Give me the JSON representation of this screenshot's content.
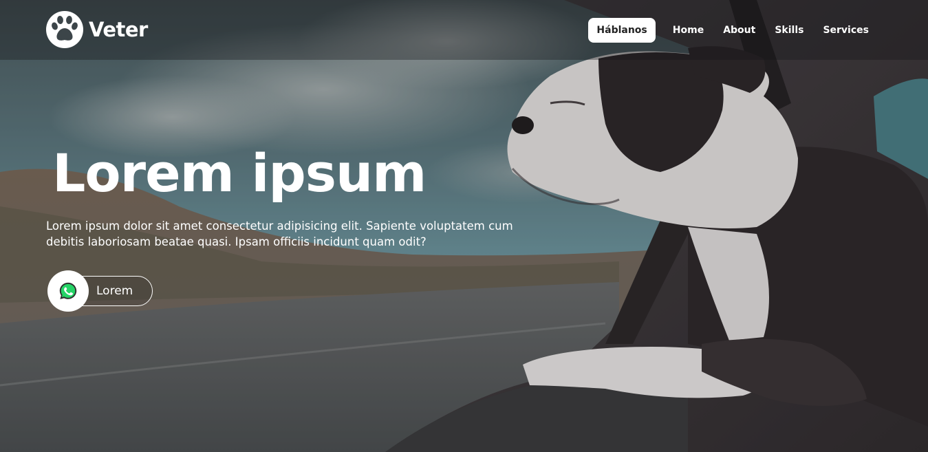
{
  "brand": {
    "name": "Veter",
    "icon": "paw-icon"
  },
  "nav": {
    "cta_label": "Háblanos",
    "links": [
      {
        "label": "Home"
      },
      {
        "label": "About"
      },
      {
        "label": "Skills"
      },
      {
        "label": "Services"
      }
    ]
  },
  "hero": {
    "title": "Lorem ipsum",
    "description": "Lorem ipsum dolor sit amet consectetur adipisicing elit. Sapiente voluptatem cum debitis laboriosam beatae quasi. Ipsam officiis incidunt quam odit?",
    "button_label": "Lorem",
    "button_icon": "whatsapp-icon",
    "background": "dog-leaning-out-car-window-photo"
  },
  "colors": {
    "text": "#ffffff",
    "whatsapp": "#25d366",
    "nav_cta_bg": "#ffffff"
  }
}
